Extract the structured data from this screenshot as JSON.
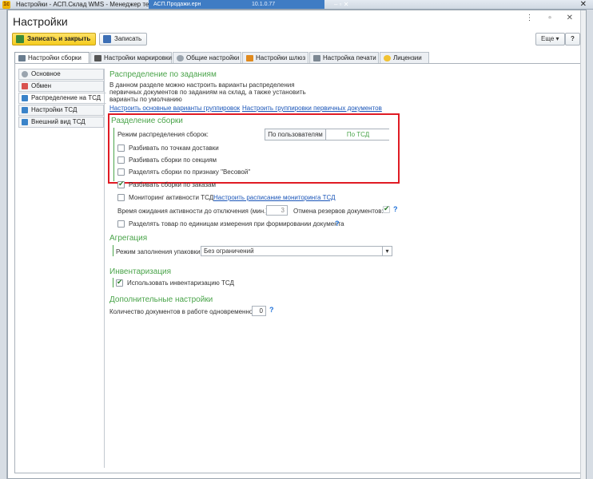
{
  "titlebar": {
    "app_icon": "1с",
    "title": "Настройки - АСП.Склад WMS  - Менеджер тестиро...",
    "tab_text": "АСП.Продажи.ерн",
    "ip": "10.1.0.77",
    "controls": "–   ▫   ✕",
    "close": "✕"
  },
  "window": {
    "title": "Настройки",
    "controls": "⋮ ▫ ✕"
  },
  "toolbar": {
    "save_close_label": "Записать и закрыть",
    "save_label": "Записать",
    "more_label": "Еще ▾",
    "help_label": "?"
  },
  "tabs": [
    {
      "label": "Настройки сборки",
      "icon": "settings-icon"
    },
    {
      "label": "Настройки маркировки",
      "icon": "barcode-icon"
    },
    {
      "label": "Общие настройки",
      "icon": "gear-icon"
    },
    {
      "label": "Настройки шлюз",
      "icon": "gateway-icon"
    },
    {
      "label": "Настройка печати",
      "icon": "printer-icon"
    },
    {
      "label": "Лицензии",
      "icon": "license-icon"
    }
  ],
  "nav": [
    {
      "label": "Основное",
      "icon": "gear-icon"
    },
    {
      "label": "Обмен",
      "icon": "exchange-icon"
    },
    {
      "label": "Распределение на ТСД",
      "icon": "tsd-icon"
    },
    {
      "label": "Настройки ТСД",
      "icon": "tsd-icon"
    },
    {
      "label": "Внешний вид ТСД",
      "icon": "tsd-icon"
    }
  ],
  "distribution": {
    "title": "Распределение по заданиям",
    "desc1": "В данном разделе можно настроить варианты распределения",
    "desc2": "первичных документов по заданиям на склад, а также установить",
    "desc3": "варианты по умолчанию",
    "link1": "Настроить основные варианты группировок",
    "link2": "Настроить группировки первичных документов"
  },
  "assembly": {
    "title": "Разделение сборки",
    "mode_label": "Режим распределения сборок:",
    "mode_options": [
      "По пользователям",
      "По ТСД"
    ],
    "mode_selected": "По ТСД",
    "checkboxes": [
      {
        "label": "Разбивать по точкам доставки",
        "checked": false
      },
      {
        "label": "Разбивать сборки по секциям",
        "checked": false
      },
      {
        "label": "Разделять сборки по признаку \"Весовой\"",
        "checked": false
      },
      {
        "label": "Разбивать сборки по заказам",
        "checked": true
      }
    ]
  },
  "monitoring": {
    "label": "Мониторинг активности ТСД",
    "checked": false,
    "link": "Настроить расписание мониторинга ТСД",
    "wait_label": "Время ожидания активности до отключения (мин.):",
    "wait_value": "3",
    "cancel_label": "Отмена резервов документов:",
    "cancel_checked": true,
    "split_label": "Разделять товар по единицам измерения при формировании документа",
    "split_checked": false
  },
  "aggregation": {
    "title": "Агрегация",
    "fill_label": "Режим заполнения упаковки:",
    "fill_value": "Без ограничений"
  },
  "inventory": {
    "title": "Инвентаризация",
    "use_label": "Использовать инвентаризацию ТСД",
    "checked": true
  },
  "additional": {
    "title": "Дополнительные настройки",
    "docs_label": "Количество документов в работе одновременно:",
    "docs_value": "0"
  },
  "help_mark": "?",
  "colors": {
    "section_title": "#4aa44a",
    "highlight": "#e01b24",
    "link": "#1a55b8",
    "primary_button": "#f5cc1f"
  }
}
